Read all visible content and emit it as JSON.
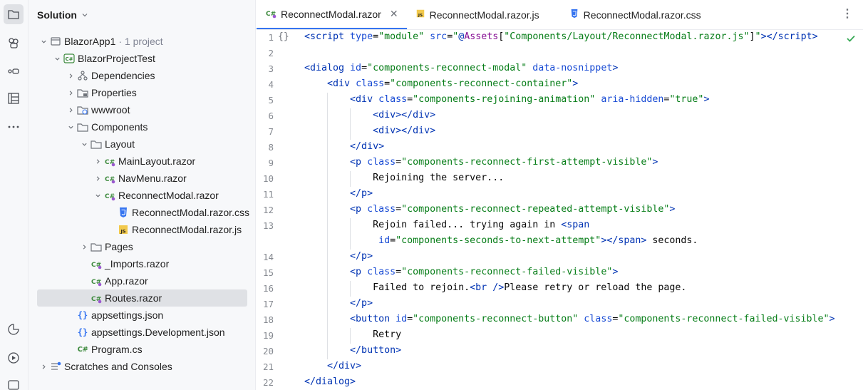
{
  "project_panel": {
    "title": "Solution",
    "tree": [
      {
        "name": "BlazorApp1",
        "hint": "· 1 project"
      },
      {
        "name": "BlazorProjectTest"
      },
      {
        "name": "Dependencies"
      },
      {
        "name": "Properties"
      },
      {
        "name": "wwwroot"
      },
      {
        "name": "Components"
      },
      {
        "name": "Layout"
      },
      {
        "name": "MainLayout.razor"
      },
      {
        "name": "NavMenu.razor"
      },
      {
        "name": "ReconnectModal.razor"
      },
      {
        "name": "ReconnectModal.razor.css"
      },
      {
        "name": "ReconnectModal.razor.js"
      },
      {
        "name": "Pages"
      },
      {
        "name": "_Imports.razor"
      },
      {
        "name": "App.razor"
      },
      {
        "name": "Routes.razor"
      },
      {
        "name": "appsettings.json"
      },
      {
        "name": "appsettings.Development.json"
      },
      {
        "name": "Program.cs"
      },
      {
        "name": "Scratches and Consoles"
      }
    ]
  },
  "tabs": [
    {
      "label": "ReconnectModal.razor",
      "icon": "csharp-razor-icon",
      "active": true
    },
    {
      "label": "ReconnectModal.razor.js",
      "icon": "js-file-icon"
    },
    {
      "label": "ReconnectModal.razor.css",
      "icon": "css-file-icon"
    }
  ],
  "editor": {
    "gutter_marker_line1": "{}",
    "line_numbers": [
      "1",
      "2",
      "3",
      "4",
      "5",
      "6",
      "7",
      "8",
      "9",
      "10",
      "11",
      "12",
      "13",
      "",
      "14",
      "15",
      "16",
      "17",
      "18",
      "19",
      "20",
      "21",
      "22"
    ]
  },
  "colors": {
    "accent": "#3574f0",
    "tag": "#0033b3",
    "attr": "#174ad4",
    "string": "#067d17",
    "ok": "#34a853"
  }
}
